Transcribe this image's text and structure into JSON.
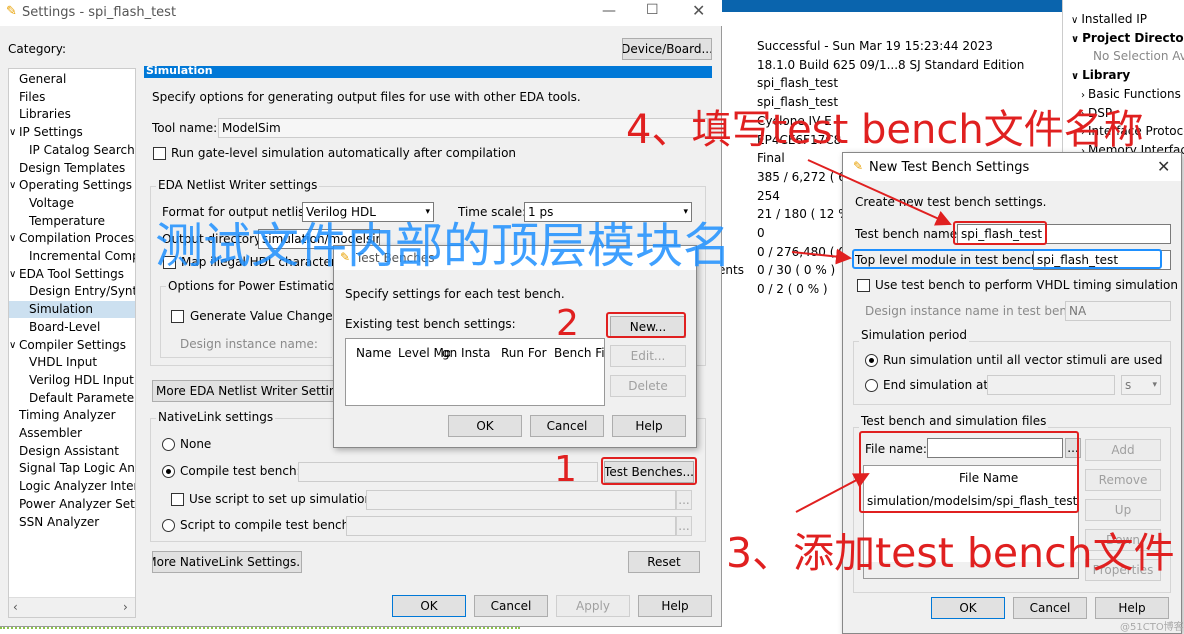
{
  "settings": {
    "title": "Settings - spi_flash_test",
    "category_label": "Category:",
    "device_board_btn": "Device/Board...",
    "categories": [
      "General",
      "Files",
      "Libraries",
      "IP Settings",
      "IP Catalog Search L",
      "Design Templates",
      "Operating Settings ar",
      "Voltage",
      "Temperature",
      "Compilation Process",
      "Incremental Compil",
      "EDA Tool Settings",
      "Design Entry/Synth",
      "Simulation",
      "Board-Level",
      "Compiler Settings",
      "VHDL Input",
      "Verilog HDL Input",
      "Default Parameters",
      "Timing Analyzer",
      "Assembler",
      "Design Assistant",
      "Signal Tap Logic Anal",
      "Logic Analyzer Interfa",
      "Power Analyzer Setti",
      "SSN Analyzer"
    ],
    "page_header": "Simulation",
    "description": "Specify options for generating output files for use with other EDA tools.",
    "tool_name_label": "Tool name:",
    "tool_name_value": "ModelSim",
    "run_gate_level": "Run gate-level simulation automatically after compilation",
    "netlist_group": "EDA Netlist Writer settings",
    "format_label": "Format for output netlist:",
    "format_value": "Verilog HDL",
    "time_scale_label": "Time scale:",
    "time_scale_value": "1 ps",
    "output_dir_label": "Output directory:",
    "output_dir_value": "simulation/modelsim",
    "map_illegal": "Map illegal HDL characters",
    "power_group": "Options for Power Estimation",
    "gen_vcd": "Generate Value Change Du",
    "design_instance_label": "Design instance name:",
    "more_eda_btn": "More EDA Netlist Writer Settings...",
    "nativelink_group": "NativeLink settings",
    "none_label": "None",
    "compile_tb_label": "Compile test bench:",
    "test_benches_btn": "Test Benches...",
    "use_script_label": "Use script to set up simulation:",
    "script_compile_label": "Script to compile test bench:",
    "browse": "...",
    "more_nativelink_btn": "More NativeLink Settings...",
    "reset_btn": "Reset",
    "ok": "OK",
    "cancel": "Cancel",
    "apply": "Apply",
    "help": "Help"
  },
  "summary": {
    "lines": [
      "Successful - Sun Mar 19 15:23:44 2023",
      "18.1.0 Build 625 09/1...8 SJ Standard Edition",
      "spi_flash_test",
      "spi_flash_test",
      "Cyclone IV E",
      "EP4CE6F17C8",
      "Final",
      "385 / 6,272 ( 6 %",
      "254",
      "21 / 180 ( 12 %",
      "0",
      "0 / 276,480 ( 0",
      "0 / 30 ( 0 % )",
      "0 / 2 ( 0 % )"
    ],
    "partial_label": "ents"
  },
  "ip_catalog": {
    "items": [
      "Installed IP",
      "Project Directory",
      "No Selection Ava",
      "Library",
      "Basic Functions",
      "DSP",
      "Interface Protoco",
      "Memory Interfac"
    ]
  },
  "test_benches": {
    "title": "Test Benches",
    "description": "Specify settings for each test bench.",
    "existing_label": "Existing test bench settings:",
    "columns": [
      "Name",
      "Level Mo",
      "gn Insta",
      "Run For",
      "Bench Fi"
    ],
    "new_btn": "New...",
    "edit_btn": "Edit...",
    "delete_btn": "Delete",
    "ok": "OK",
    "cancel": "Cancel",
    "help": "Help"
  },
  "new_tb": {
    "title": "New Test Bench Settings",
    "description": "Create new test bench settings.",
    "name_label": "Test bench name:",
    "name_value": "spi_flash_test",
    "top_label": "Top level module in test bench:",
    "top_value": "spi_flash_test",
    "vhdl_timing": "Use test bench to perform VHDL timing simulation",
    "design_instance_label": "Design instance name in test bench:",
    "design_instance_value": "NA",
    "sim_period": "Simulation period",
    "run_until": "Run simulation until all vector stimuli are used",
    "end_sim_at": "End simulation at:",
    "unit": "s",
    "files_group": "Test bench and simulation files",
    "file_name_label": "File name:",
    "browse": "...",
    "file_col": "File Name",
    "file_row": "simulation/modelsim/spi_flash_test.vt",
    "add_btn": "Add",
    "remove_btn": "Remove",
    "up_btn": "Up",
    "down_btn": "Down",
    "props_btn": "Properties",
    "ok": "OK",
    "cancel": "Cancel",
    "help": "Help"
  },
  "annotations": {
    "a1": "1",
    "a2": "2",
    "a3": "3、添加test bench文件",
    "a4": "4、填写test bench文件名称",
    "overlay": "测试文件内部的顶层模块名"
  },
  "watermark": "@51CTO博客",
  "colors": {
    "accent": "#0078d7",
    "annotation": "#e02020",
    "highlight": "#1e90ff"
  }
}
